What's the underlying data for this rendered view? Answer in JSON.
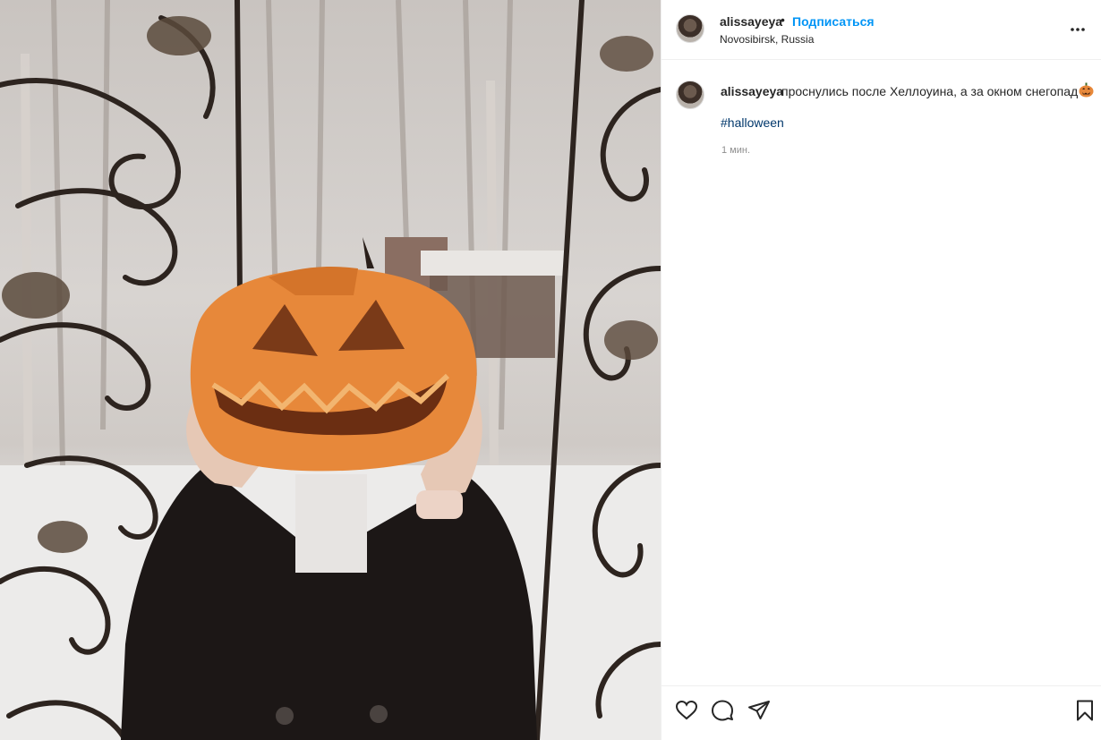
{
  "post": {
    "username": "alissayeya",
    "separator": "•",
    "follow_label": "Подписаться",
    "location": "Novosibirsk, Russia",
    "more_icon": "more-horizontal-icon"
  },
  "caption": {
    "username": "alissayeya",
    "text": "проснулись после Хеллоуина, а за окном снегопад",
    "emoji": "jack-o-lantern-icon",
    "hashtag": "#halloween",
    "time": "1 мин."
  },
  "actions": {
    "like_icon": "heart-icon",
    "comment_icon": "comment-icon",
    "share_icon": "send-icon",
    "save_icon": "bookmark-icon"
  },
  "colors": {
    "accent": "#0095f6",
    "hashtag": "#00376b",
    "muted": "#8e8e8e",
    "pumpkin": "#e7883a"
  }
}
